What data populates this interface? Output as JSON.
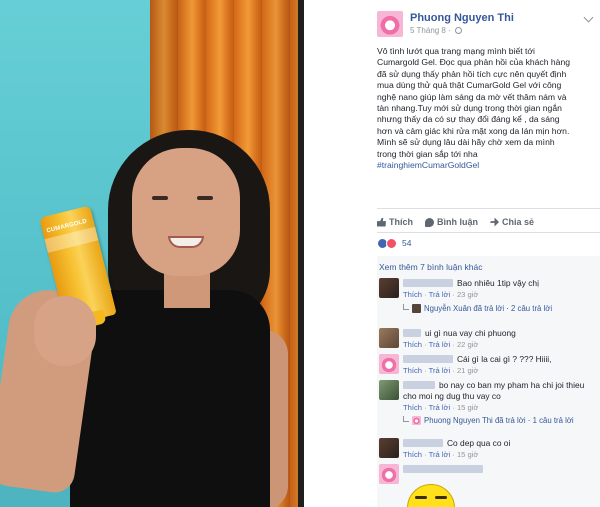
{
  "post": {
    "author": "Phuong Nguyen Thi",
    "date": "5 Tháng 8 ·",
    "text_lines": [
      "Vô tình lướt qua trang mạng mình biết tới",
      "Cumargold Gel. Đọc qua phản hồi của khách hàng",
      "đã sử dụng thấy phản hồi tích cực nên quyết định",
      "mua dùng thử quả thật CumarGold Gel với công",
      "nghệ nano giúp làm sáng da mờ vết thâm nám và",
      "tàn nhang.Tuy mới sử dụng trong thời gian ngắn",
      "nhưng thấy da có sự thay đổi đáng kể , da sáng",
      "hơn và cảm giác khi rửa mặt xong da lán mịn hơn.",
      "Mình sẽ sử dụng lâu dài hãy chờ xem da mình",
      "trong thời gian sắp tới nha"
    ],
    "hashtag": "#trainghiemCumarGoldGel",
    "product_label": "CUMARGOLD"
  },
  "actions": {
    "like": "Thích",
    "comment": "Bình luận",
    "share": "Chia sẻ"
  },
  "reactions": {
    "count": "54"
  },
  "comments": {
    "view_more": "Xem thêm 7 bình luận khác",
    "reply_label": "Trả lời",
    "like_label": "Thích",
    "items": [
      {
        "text": "Bao nhiêu 1tip vậy chị",
        "time": "23 giờ",
        "reply_by": "Nguyễn Xuân đã trả lời",
        "reply_count": "2 câu trả lời"
      },
      {
        "text": "ui gì nua vay chi phuong",
        "time": "22 giờ"
      },
      {
        "text": "Cái gì la cai gì ? ??? Hiiii,",
        "time": "21 giờ"
      },
      {
        "text": "bo nay co ban my pham ha chi joi thieu",
        "text2": "cho moi ng dug thu vay co",
        "time": "15 giờ",
        "reply_by": "Phuong Nguyen Thi đã trả lời",
        "reply_count": "1 câu trả lời"
      },
      {
        "text": "Co dep qua co oi",
        "time": "15 giờ"
      }
    ]
  }
}
